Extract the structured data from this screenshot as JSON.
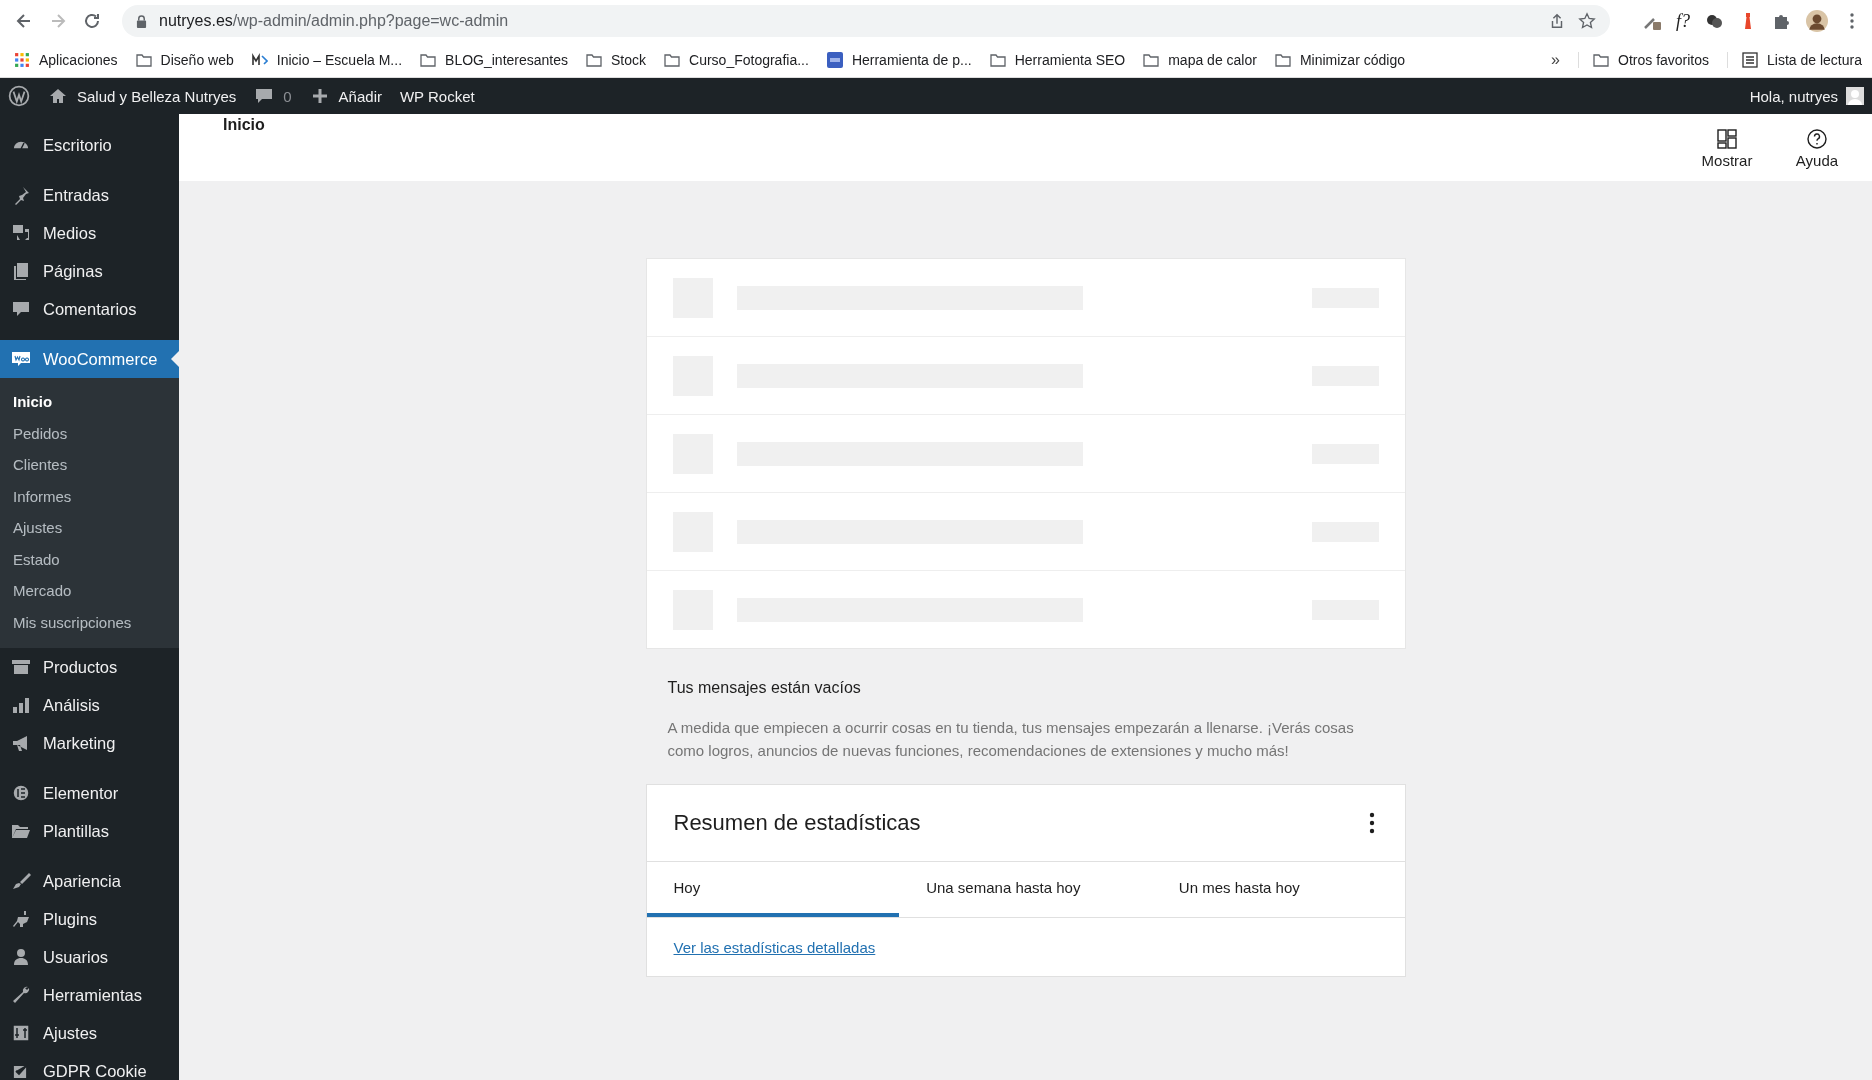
{
  "browser": {
    "url_host": "nutryes.es",
    "url_path": "/wp-admin/admin.php?page=wc-admin",
    "extension_label": "f?"
  },
  "bookmarks": [
    {
      "kind": "apps",
      "label": "Aplicaciones"
    },
    {
      "kind": "folder",
      "label": "Diseño web"
    },
    {
      "kind": "site",
      "label": "Inicio – Escuela M..."
    },
    {
      "kind": "folder",
      "label": "BLOG_interesantes"
    },
    {
      "kind": "folder",
      "label": "Stock"
    },
    {
      "kind": "folder",
      "label": "Curso_Fotografia..."
    },
    {
      "kind": "ims",
      "label": "Herramienta de p..."
    },
    {
      "kind": "folder",
      "label": "Herramienta SEO"
    },
    {
      "kind": "folder",
      "label": "mapa de calor"
    },
    {
      "kind": "folder",
      "label": "Minimizar código"
    }
  ],
  "bookmarks_more": "»",
  "bookmarks_right": [
    {
      "kind": "folder",
      "label": "Otros favoritos"
    },
    {
      "kind": "list",
      "label": "Lista de lectura"
    }
  ],
  "admin_bar": {
    "site": "Salud y Belleza Nutryes",
    "comments": "0",
    "add": "Añadir",
    "rocket": "WP Rocket",
    "greeting": "Hola, nutryes"
  },
  "menu_groups": [
    [
      {
        "label": "Escritorio",
        "selected": false
      }
    ],
    [
      {
        "label": "Entradas",
        "selected": false
      },
      {
        "label": "Medios",
        "selected": false
      },
      {
        "label": "Páginas",
        "selected": false
      },
      {
        "label": "Comentarios",
        "selected": false
      }
    ],
    [
      {
        "label": "WooCommerce",
        "selected": true,
        "children": [
          {
            "label": "Inicio",
            "selected": true
          },
          {
            "label": "Pedidos",
            "selected": false
          },
          {
            "label": "Clientes",
            "selected": false
          },
          {
            "label": "Informes",
            "selected": false
          },
          {
            "label": "Ajustes",
            "selected": false
          },
          {
            "label": "Estado",
            "selected": false
          },
          {
            "label": "Mercado",
            "selected": false
          },
          {
            "label": "Mis suscripciones",
            "selected": false
          }
        ]
      },
      {
        "label": "Productos",
        "selected": false
      },
      {
        "label": "Análisis",
        "selected": false
      },
      {
        "label": "Marketing",
        "selected": false
      }
    ],
    [
      {
        "label": "Elementor",
        "selected": false
      },
      {
        "label": "Plantillas",
        "selected": false
      }
    ],
    [
      {
        "label": "Apariencia",
        "selected": false
      },
      {
        "label": "Plugins",
        "selected": false
      },
      {
        "label": "Usuarios",
        "selected": false
      },
      {
        "label": "Herramientas",
        "selected": false
      },
      {
        "label": "Ajustes",
        "selected": false
      },
      {
        "label": "GDPR Cookie",
        "selected": false
      }
    ]
  ],
  "header": {
    "title": "Inicio",
    "actions": [
      {
        "kind": "display",
        "label": "Mostrar"
      },
      {
        "kind": "help",
        "label": "Ayuda"
      }
    ]
  },
  "messages": {
    "title": "Tus mensajes están vacíos",
    "body": "A medida que empiecen a ocurrir cosas en tu tienda, tus mensajes empezarán a llenarse. ¡Verás cosas como logros, anuncios de nuevas funciones, recomendaciones de extensiones y mucho más!"
  },
  "stats": {
    "title": "Resumen de estadísticas",
    "tabs": [
      {
        "label": "Hoy",
        "selected": true
      },
      {
        "label": "Una semana hasta hoy",
        "selected": false
      },
      {
        "label": "Un mes hasta hoy",
        "selected": false
      }
    ],
    "link": "Ver las estadísticas detalladas"
  }
}
